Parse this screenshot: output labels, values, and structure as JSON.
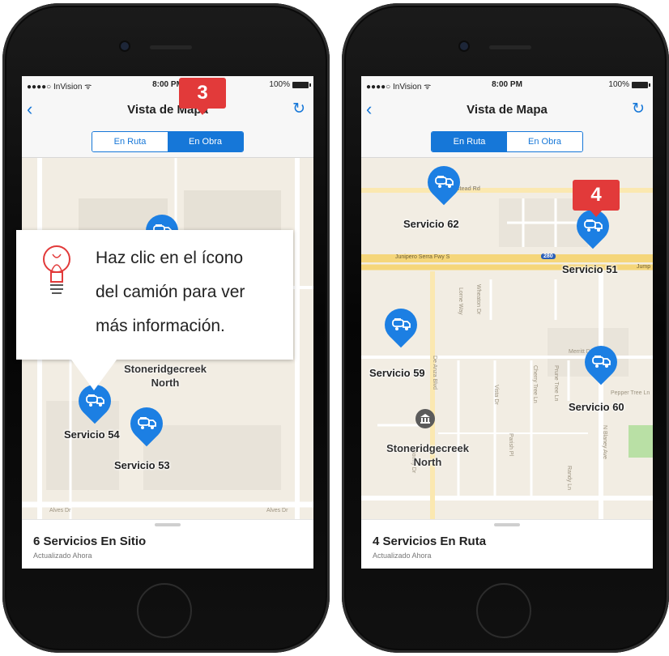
{
  "left_screen": {
    "status": {
      "carrier": "●●●●○ InVision ᯤ",
      "time": "8:00 PM",
      "battery": "100%"
    },
    "nav": {
      "title": "Vista de Mapa",
      "back_icon": "chevron-left-icon",
      "refresh_icon": "refresh-icon"
    },
    "segments": [
      {
        "label": "En Ruta",
        "active": false
      },
      {
        "label": "En Obra",
        "active": true
      }
    ],
    "pins": [
      {
        "label": "Servicio 54"
      },
      {
        "label": "Servicio 53"
      }
    ],
    "place": {
      "line1": "Stoneridgecreek",
      "line2": "North"
    },
    "sheet": {
      "title": "6 Servicios En Sitio",
      "subtitle": "Actualizado Ahora"
    },
    "map_labels": {
      "street_bottom_left": "Alves Dr",
      "street_bottom_right": "Alves Dr"
    }
  },
  "right_screen": {
    "status": {
      "carrier": "●●●●○ InVision ᯤ",
      "time": "8:00 PM",
      "battery": "100%"
    },
    "nav": {
      "title": "Vista de Mapa",
      "back_icon": "chevron-left-icon",
      "refresh_icon": "refresh-icon"
    },
    "segments": [
      {
        "label": "En Ruta",
        "active": true
      },
      {
        "label": "En Obra",
        "active": false
      }
    ],
    "pins": [
      {
        "label": "Servicio 62"
      },
      {
        "label": "Servicio 51"
      },
      {
        "label": "Servicio 59"
      },
      {
        "label": "Servicio 60"
      }
    ],
    "place": {
      "line1": "Stoneridgecreek",
      "line2": "North"
    },
    "sheet": {
      "title": "4 Servicios En Ruta",
      "subtitle": "Actualizado Ahora"
    },
    "map_labels": {
      "homestead": "Homestead Rd",
      "highway": "Junipero Serra Fwy S",
      "shield": "280",
      "jumper": "Jump",
      "merritt": "Merritt Dr",
      "pepper": "Pepper Tree Ln",
      "deanza": "De Anza Blvd",
      "blaney": "N Blaney Ave",
      "vista": "Vista Dr",
      "perish": "Parish Pl",
      "randy": "Randy Ln",
      "cherry": "Cherry Tree Ln",
      "prune": "Prune Tree Ln",
      "wheaton": "Wheaton Dr",
      "lorne": "Lorne Way",
      "bonny": "Bonny Dr"
    }
  },
  "badges": {
    "left": "3",
    "right": "4"
  },
  "tip": {
    "icon": "lightbulb-icon",
    "lines": [
      "Haz clic en el ícono",
      "del camión para ver",
      "más información."
    ]
  },
  "colors": {
    "accent": "#1677d8",
    "pin": "#1c7fe3",
    "badge": "#e23a3a",
    "map_bg": "#f2ede3",
    "highway": "#f5d67a"
  }
}
